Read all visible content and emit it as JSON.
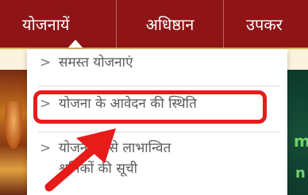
{
  "nav": {
    "items": [
      {
        "label": "योजनायें"
      },
      {
        "label": "अधिष्ठान"
      },
      {
        "label": "उपकर"
      }
    ]
  },
  "dropdown": {
    "items": [
      {
        "label": "समस्त योजनाएं"
      },
      {
        "label": "योजना के आवेदन की स्थिति"
      },
      {
        "label_line1": "योजनाओं से लाभान्वित",
        "label_line2": "श्रमिकों की सूची"
      }
    ]
  },
  "colors": {
    "nav_background": "#8f1416",
    "highlight": "#e81b1b"
  }
}
